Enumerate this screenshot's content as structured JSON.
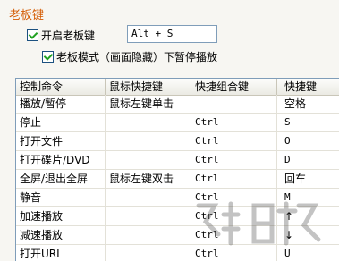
{
  "group": {
    "title": "老板键"
  },
  "boss_key": {
    "enable_label": "开启老板键",
    "hotkey_value": "Alt + S",
    "pause_label": "老板模式（画面隐藏）下暂停播放"
  },
  "table": {
    "headers": [
      "控制命令",
      "鼠标快捷键",
      "快捷组合键",
      "快捷键"
    ],
    "rows": [
      [
        "播放/暂停",
        "鼠标左键单击",
        "",
        "空格"
      ],
      [
        "停止",
        "",
        "Ctrl",
        "S"
      ],
      [
        "打开文件",
        "",
        "Ctrl",
        "O"
      ],
      [
        "打开碟片/DVD",
        "",
        "Ctrl",
        "D"
      ],
      [
        "全屏/退出全屏",
        "鼠标左键双击",
        "Ctrl",
        "回车"
      ],
      [
        "静音",
        "",
        "Ctrl",
        "M"
      ],
      [
        "加速播放",
        "",
        "Ctrl",
        "↑"
      ],
      [
        "减速播放",
        "",
        "Ctrl",
        "↓"
      ],
      [
        "打开URL",
        "",
        "Ctrl",
        "U"
      ]
    ]
  },
  "colors": {
    "group_title": "#d45a00",
    "check": "#21a121",
    "border": "#7f9db9"
  }
}
